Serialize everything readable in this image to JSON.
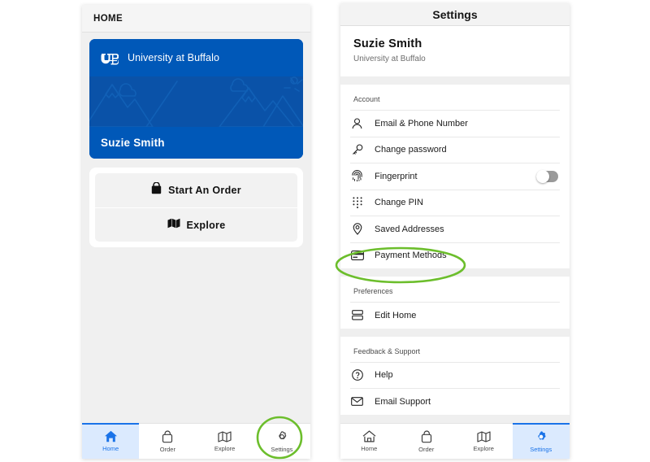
{
  "left_phone": {
    "header": {
      "title": "HOME"
    },
    "hero_card": {
      "org_name": "University at Buffalo",
      "logo_icon": "ub-monogram-icon",
      "user_name": "Suzie Smith",
      "art_icon": "mountains-clouds-sun-illustration",
      "brand_color": "#0058b8",
      "art_color": "#0a52a8"
    },
    "actions": [
      {
        "label": "Start An Order",
        "icon": "shopping-bag-icon"
      },
      {
        "label": "Explore",
        "icon": "map-icon"
      }
    ],
    "tabbar": {
      "active": "Home",
      "tabs": [
        {
          "label": "Home",
          "icon": "home-icon"
        },
        {
          "label": "Order",
          "icon": "shopping-bag-icon"
        },
        {
          "label": "Explore",
          "icon": "map-icon"
        },
        {
          "label": "Settings",
          "icon": "gear-icon"
        }
      ]
    }
  },
  "right_phone": {
    "header": {
      "title": "Settings"
    },
    "profile": {
      "name": "Suzie Smith",
      "org": "University at Buffalo"
    },
    "sections": [
      {
        "title": "Account",
        "rows": [
          {
            "label": "Email & Phone Number",
            "icon": "person-icon",
            "control": "none"
          },
          {
            "label": "Change password",
            "icon": "key-icon",
            "control": "none"
          },
          {
            "label": "Fingerprint",
            "icon": "fingerprint-icon",
            "control": "toggle",
            "toggle_on": false
          },
          {
            "label": "Change PIN",
            "icon": "keypad-dots-icon",
            "control": "none"
          },
          {
            "label": "Saved Addresses",
            "icon": "location-pin-icon",
            "control": "none"
          },
          {
            "label": "Payment Methods",
            "icon": "credit-card-icon",
            "control": "none"
          }
        ]
      },
      {
        "title": "Preferences",
        "rows": [
          {
            "label": "Edit Home",
            "icon": "stacked-bars-icon",
            "control": "none"
          }
        ]
      },
      {
        "title": "Feedback & Support",
        "rows": [
          {
            "label": "Help",
            "icon": "question-circle-icon",
            "control": "none"
          },
          {
            "label": "Email Support",
            "icon": "envelope-icon",
            "control": "none"
          }
        ]
      }
    ],
    "tabbar": {
      "active": "Settings",
      "tabs": [
        {
          "label": "Home",
          "icon": "home-icon"
        },
        {
          "label": "Order",
          "icon": "shopping-bag-icon"
        },
        {
          "label": "Explore",
          "icon": "map-icon"
        },
        {
          "label": "Settings",
          "icon": "gear-icon"
        }
      ]
    }
  },
  "annotations": {
    "color": "#6cbe2c",
    "items": [
      {
        "shape": "ellipse",
        "target": "Payment Methods"
      },
      {
        "shape": "circle",
        "target": "Settings"
      }
    ]
  }
}
